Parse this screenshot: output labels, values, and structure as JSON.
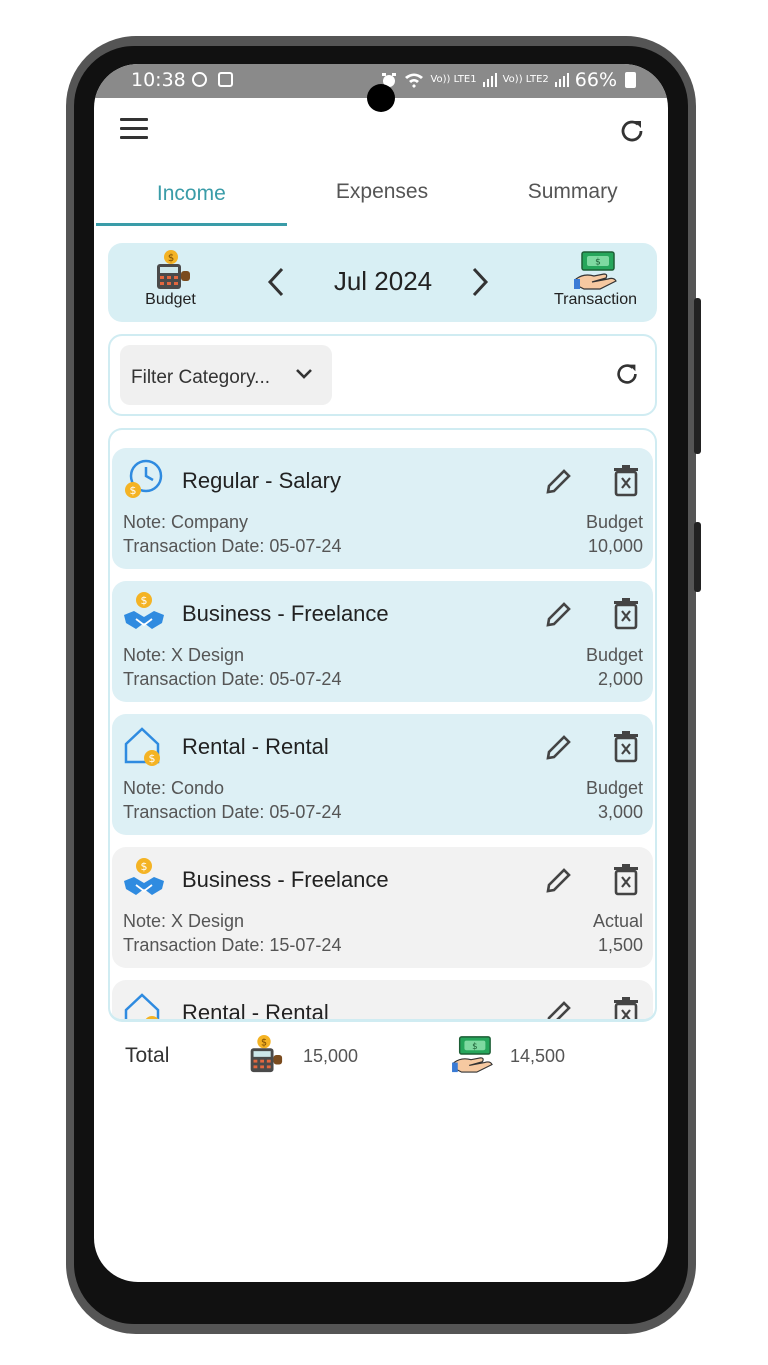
{
  "status_bar": {
    "time": "10:38",
    "net1": "Vo)) LTE1",
    "net2": "Vo)) LTE2",
    "battery": "66%"
  },
  "header": {
    "menu_icon": "menu-icon",
    "refresh_icon": "refresh-icon"
  },
  "tabs": [
    {
      "label": "Income",
      "active": true
    },
    {
      "label": "Expenses",
      "active": false
    },
    {
      "label": "Summary",
      "active": false
    }
  ],
  "month_bar": {
    "budget_label": "Budget",
    "month": "Jul 2024",
    "transaction_label": "Transaction"
  },
  "filter": {
    "placeholder": "Filter Category..."
  },
  "colors": {
    "accent": "#3a9ca8",
    "budget_card": "#ddf0f5",
    "actual_card": "#f2f2f2",
    "month_bar": "#d8eff4"
  },
  "entries": [
    {
      "icon": "clock-money-icon",
      "title": "Regular - Salary",
      "note": "Note: Company",
      "date": "Transaction Date: 05-07-24",
      "type": "Budget",
      "amount": "10,000"
    },
    {
      "icon": "handshake-money-icon",
      "title": "Business - Freelance",
      "note": "Note: X Design",
      "date": "Transaction Date: 05-07-24",
      "type": "Budget",
      "amount": "2,000"
    },
    {
      "icon": "house-money-icon",
      "title": "Rental - Rental",
      "note": "Note: Condo",
      "date": "Transaction Date: 05-07-24",
      "type": "Budget",
      "amount": "3,000"
    },
    {
      "icon": "handshake-money-icon",
      "title": "Business - Freelance",
      "note": "Note: X Design",
      "date": "Transaction Date: 15-07-24",
      "type": "Actual",
      "amount": "1,500"
    },
    {
      "icon": "house-money-icon",
      "title": "Rental - Rental"
    }
  ],
  "totals": {
    "label": "Total",
    "budget_total": "15,000",
    "transaction_total": "14,500"
  }
}
